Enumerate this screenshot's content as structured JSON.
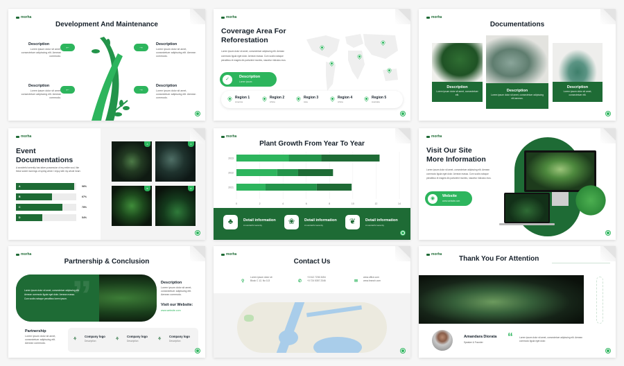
{
  "brand": "morha",
  "colors": {
    "accent": "#2db55d",
    "dark_green": "#1e6b35",
    "mid_green": "#23944a",
    "text": "#16202a"
  },
  "lorem_short": "Lorem ipsum dolor sit amet, consectetuer adipiscing elit. Aenean commodo.",
  "slides": {
    "s1": {
      "title": "Development And Maintenance",
      "items": [
        {
          "label": "Description",
          "text": "Lorem ipsum dolor sit amet, consectetuer adipiscing elit. Aenean commodo.",
          "icon": "arrow-left-icon"
        },
        {
          "label": "Description",
          "text": "Lorem ipsum dolor sit amet, consectetuer adipiscing elit. Aenean commodo.",
          "icon": "arrow-right-icon"
        },
        {
          "label": "Description",
          "text": "Lorem ipsum dolor sit amet, consectetuer adipiscing elit. Aenean commodo.",
          "icon": "arrow-left-icon"
        },
        {
          "label": "Description",
          "text": "Lorem ipsum dolor sit amet, consectetuer adipiscing elit. Aenean commodo.",
          "icon": "arrow-right-icon"
        }
      ]
    },
    "s2": {
      "title_1": "Coverage Area For",
      "title_2": "Reforestation",
      "text": "Lorem ipsum dolor sit amet, consectetuer adipiscing elit. Aenean commodo ligula eget dolor. Aenean massa. Cum sociis natoque penatibus et magnis dis parturient montes, nascetur ridiculus mus.",
      "pill_title": "Description",
      "pill_sub": "Lorem ipsum",
      "regions": [
        {
          "name": "Region 1",
          "sub": "America"
        },
        {
          "name": "Region 2",
          "sub": "Africa"
        },
        {
          "name": "Region 3",
          "sub": "Asia"
        },
        {
          "name": "Region 4",
          "sub": "Africa"
        },
        {
          "name": "Region 5",
          "sub": "Australia"
        }
      ]
    },
    "s3": {
      "title": "Documentations",
      "cards": [
        {
          "title": "Description",
          "text": "Lorem ipsum dolor sit amet, consectetuer elit."
        },
        {
          "title": "Description",
          "text": "Lorem ipsum dolor sit amet, consectetuer adipiscing elit aenean."
        },
        {
          "title": "Description",
          "text": "Lorem ipsum dolor sit amet, consectetuer elit."
        }
      ]
    },
    "s4": {
      "title_1": "Event",
      "title_2": "Documentations",
      "text": "A wonderful serenity has taken possession of my entire soul, like these sweet mornings of spring which I enjoy with my whole heart.",
      "bars": [
        {
          "label": "A",
          "value": 96,
          "pct": "96%"
        },
        {
          "label": "B",
          "value": 67,
          "pct": "67%"
        },
        {
          "label": "C",
          "value": 78,
          "pct": "78%"
        },
        {
          "label": "D",
          "value": 54,
          "pct": "54%"
        }
      ],
      "photo_badges": [
        "A",
        "C",
        "B",
        "R"
      ]
    },
    "s5": {
      "title": "Plant Growth From Year To Year",
      "footer": [
        {
          "title": "Detail information",
          "sub": "A wonderful serenity",
          "icon": "clover-icon"
        },
        {
          "title": "Detail information",
          "sub": "A wonderful serenity",
          "icon": "maple-leaf-icon"
        },
        {
          "title": "Detail information",
          "sub": "A wonderful serenity",
          "icon": "leaf-icon"
        }
      ]
    },
    "s6": {
      "title_1": "Visit Our Site",
      "title_2": "More Information",
      "text": "Lorem ipsum dolor sit amet, consectetuer adipiscing elit. Aenean commodo ligula eget dolor. Aenean massa. Cum sociis natoque penatibus et magnis dis parturient montes, nascetur ridiculus mus.",
      "pill_title": "Website",
      "pill_sub": "www.website.com"
    },
    "s7": {
      "title": "Partnership & Conclusion",
      "quote": "Lorem ipsum dolor sit amet, consectetuer adipiscing elit. Aenean commodo ligula eget dolor. Aenean massa. Cum sociis natoque penatibus lorem ipsum.",
      "desc_title": "Description",
      "desc_text": "Lorem ipsum dolor sit amet, consectetuer adipiscing elit. Aenean commodo.",
      "visit_title": "Visit our Website:",
      "visit_url": "www.website.com",
      "partnership_title": "Partnership",
      "partnership_text": "Lorem ipsum dolor sit amet, consectetuer adipiscing elit. Aenean commodo.",
      "companies": [
        {
          "name": "Company logo",
          "sub": "Description"
        },
        {
          "name": "Company logo",
          "sub": "Description"
        },
        {
          "name": "Company logo",
          "sub": "Description"
        }
      ]
    },
    "s8": {
      "title": "Contact Us",
      "address_1": "Lorem ipsum dolor sit",
      "address_2": "Block C 12, No 113",
      "phone_1": "+0 612 7236 3454",
      "phone_2": "+0 724 5357 2346",
      "web_1": "www.office.com",
      "web_2": "www.branch.com"
    },
    "s9": {
      "title": "Thank You For Attention",
      "name": "Amandara Diorata",
      "role": "Speaker & Founder",
      "quote": "Lorem ipsum dolor sit amet, consectetuer adipiscing elit. Aenean commodo ligula eget dolor."
    }
  },
  "chart_data": {
    "type": "bar",
    "orientation": "horizontal",
    "stacked": true,
    "title": "Plant Growth From Year To Year",
    "categories": [
      "2023",
      "2022",
      "2021"
    ],
    "series": [
      {
        "values": [
          4.5,
          3.5,
          2.5
        ],
        "color": "#2db55d"
      },
      {
        "values": [
          2.8,
          1.8,
          4.4
        ],
        "color": "#23944a"
      },
      {
        "values": [
          5.0,
          3.0,
          3.0
        ],
        "color": "#1e6b35"
      }
    ],
    "xlim": [
      0,
      14
    ],
    "xticks": [
      "0",
      "2",
      "4",
      "6",
      "8",
      "10",
      "12",
      "14"
    ],
    "grid": true
  }
}
